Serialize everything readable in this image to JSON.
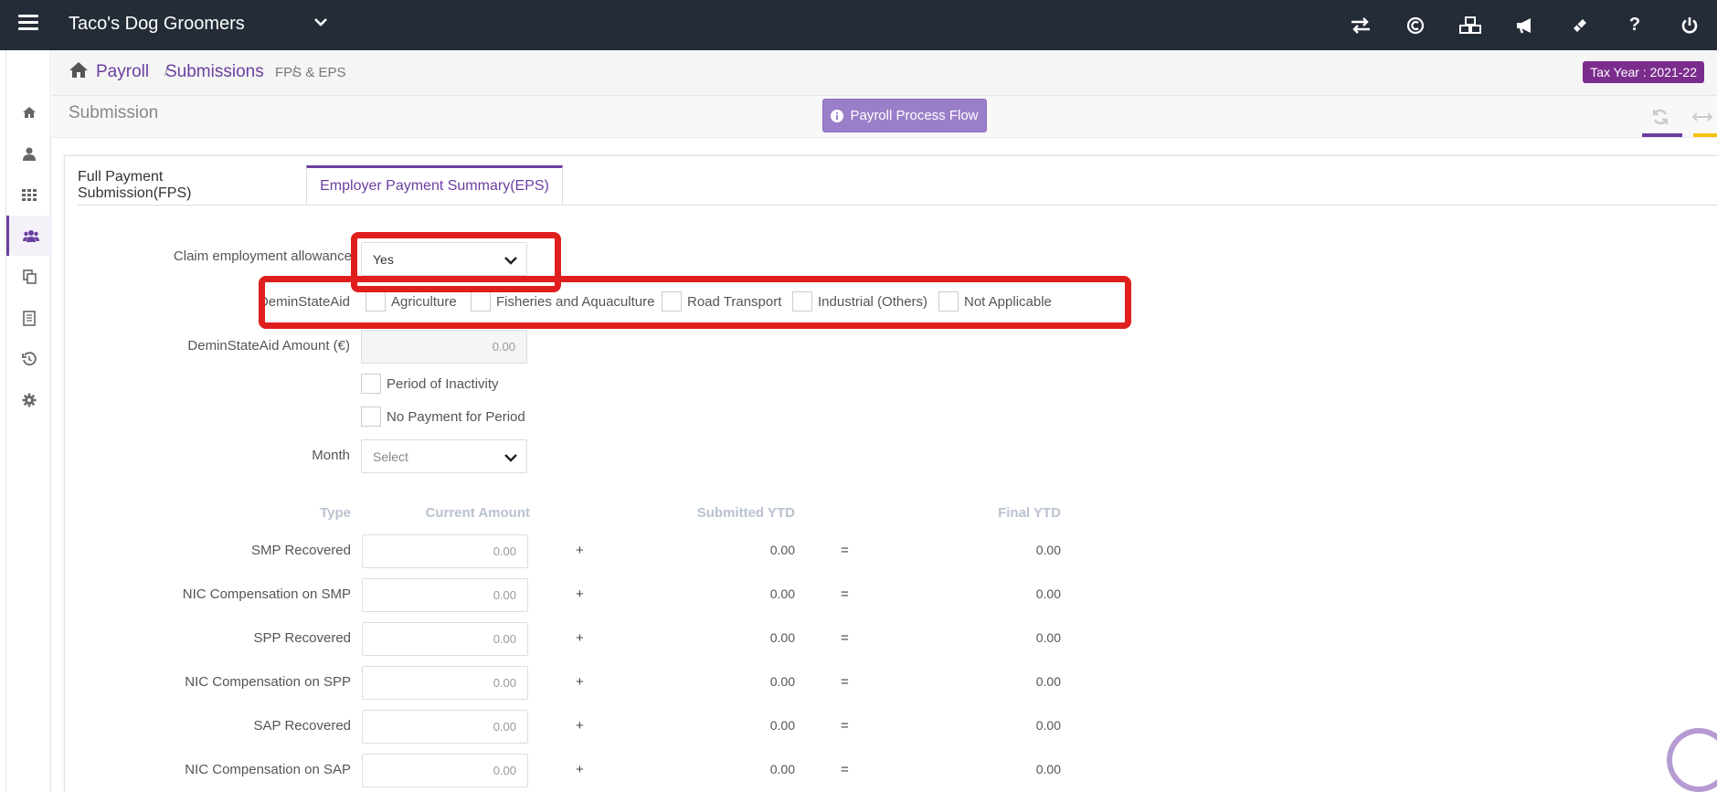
{
  "header": {
    "company": "Taco's Dog Groomers",
    "icons": [
      "swap-icon",
      "currency-icon",
      "cubes-icon",
      "megaphone-icon",
      "ticket-icon",
      "help-icon",
      "power-icon"
    ],
    "help_glyph": "?",
    "background": "#242c38"
  },
  "sidebar": {
    "items": [
      "home-icon",
      "user-icon",
      "grid-icon",
      "users-icon",
      "copy-icon",
      "document-icon",
      "history-icon",
      "gear-icon"
    ],
    "active_index": 3,
    "accent": "#6b3fa0"
  },
  "breadcrumb": {
    "items": [
      "Payroll",
      "Submissions"
    ],
    "separator": "/",
    "current": "FPS & EPS",
    "tax_year": "Tax Year : 2021-22"
  },
  "page": {
    "title": "Submission",
    "process_flow_button": "Payroll Process Flow"
  },
  "tabs": [
    {
      "label": "Full Payment Submission(FPS)",
      "active": false
    },
    {
      "label": "Employer Payment Summary(EPS)",
      "active": true
    }
  ],
  "form": {
    "claim_label": "Claim employment allowance",
    "claim_value": "Yes",
    "demin_label": "DeminStateAid",
    "demin_options": [
      "Agriculture",
      "Fisheries and Aquaculture",
      "Road Transport",
      "Industrial (Others)",
      "Not Applicable"
    ],
    "demin_amount_label": "DeminStateAid Amount (€)",
    "demin_amount_value": "0.00",
    "period_inactivity": "Period of Inactivity",
    "no_payment": "No Payment for Period",
    "month_label": "Month",
    "month_value": "Select"
  },
  "table": {
    "headers": {
      "type": "Type",
      "current": "Current Amount",
      "submitted": "Submitted YTD",
      "final": "Final YTD"
    },
    "plus": "+",
    "equals": "=",
    "rows": [
      {
        "type": "SMP Recovered",
        "current": "0.00",
        "submitted": "0.00",
        "final": "0.00"
      },
      {
        "type": "NIC Compensation on SMP",
        "current": "0.00",
        "submitted": "0.00",
        "final": "0.00"
      },
      {
        "type": "SPP Recovered",
        "current": "0.00",
        "submitted": "0.00",
        "final": "0.00"
      },
      {
        "type": "NIC Compensation on SPP",
        "current": "0.00",
        "submitted": "0.00",
        "final": "0.00"
      },
      {
        "type": "SAP Recovered",
        "current": "0.00",
        "submitted": "0.00",
        "final": "0.00"
      },
      {
        "type": "NIC Compensation on SAP",
        "current": "0.00",
        "submitted": "0.00",
        "final": "0.00"
      }
    ]
  },
  "colors": {
    "accent": "#6b3fa0",
    "highlight": "#e01e1e",
    "tax_badge": "#7b2d8e",
    "flow_button": "#9b7ec9"
  }
}
